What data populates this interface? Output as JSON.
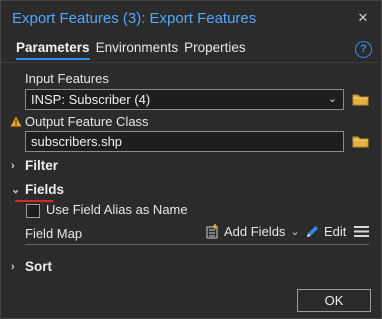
{
  "window": {
    "title": "Export Features (3): Export Features"
  },
  "tabs": [
    {
      "label": "Parameters",
      "active": true
    },
    {
      "label": "Environments",
      "active": false
    },
    {
      "label": "Properties",
      "active": false
    }
  ],
  "help_label": "?",
  "input_features": {
    "label": "Input Features",
    "value": "INSP: Subscriber (4)"
  },
  "output_feature_class": {
    "label": "Output Feature Class",
    "value": "subscribers.shp",
    "warning": true
  },
  "sections": {
    "filter": {
      "label": "Filter",
      "expanded": false
    },
    "fields": {
      "label": "Fields",
      "expanded": true
    },
    "sort": {
      "label": "Sort",
      "expanded": false
    }
  },
  "fields": {
    "use_alias_label": "Use Field Alias as Name",
    "use_alias_checked": false,
    "field_map_label": "Field Map",
    "add_fields_label": "Add Fields",
    "edit_label": "Edit"
  },
  "buttons": {
    "ok_label": "OK"
  },
  "colors": {
    "accent": "#2f8cf0",
    "title": "#52a8ff",
    "warning": "#f0a30a",
    "highlight": "#d12b2b"
  },
  "icons": [
    "close-icon",
    "help-icon",
    "chevron-down-icon",
    "folder-icon",
    "warning-icon",
    "chevron-right-icon",
    "add-fields-icon",
    "pencil-icon",
    "menu-icon"
  ]
}
